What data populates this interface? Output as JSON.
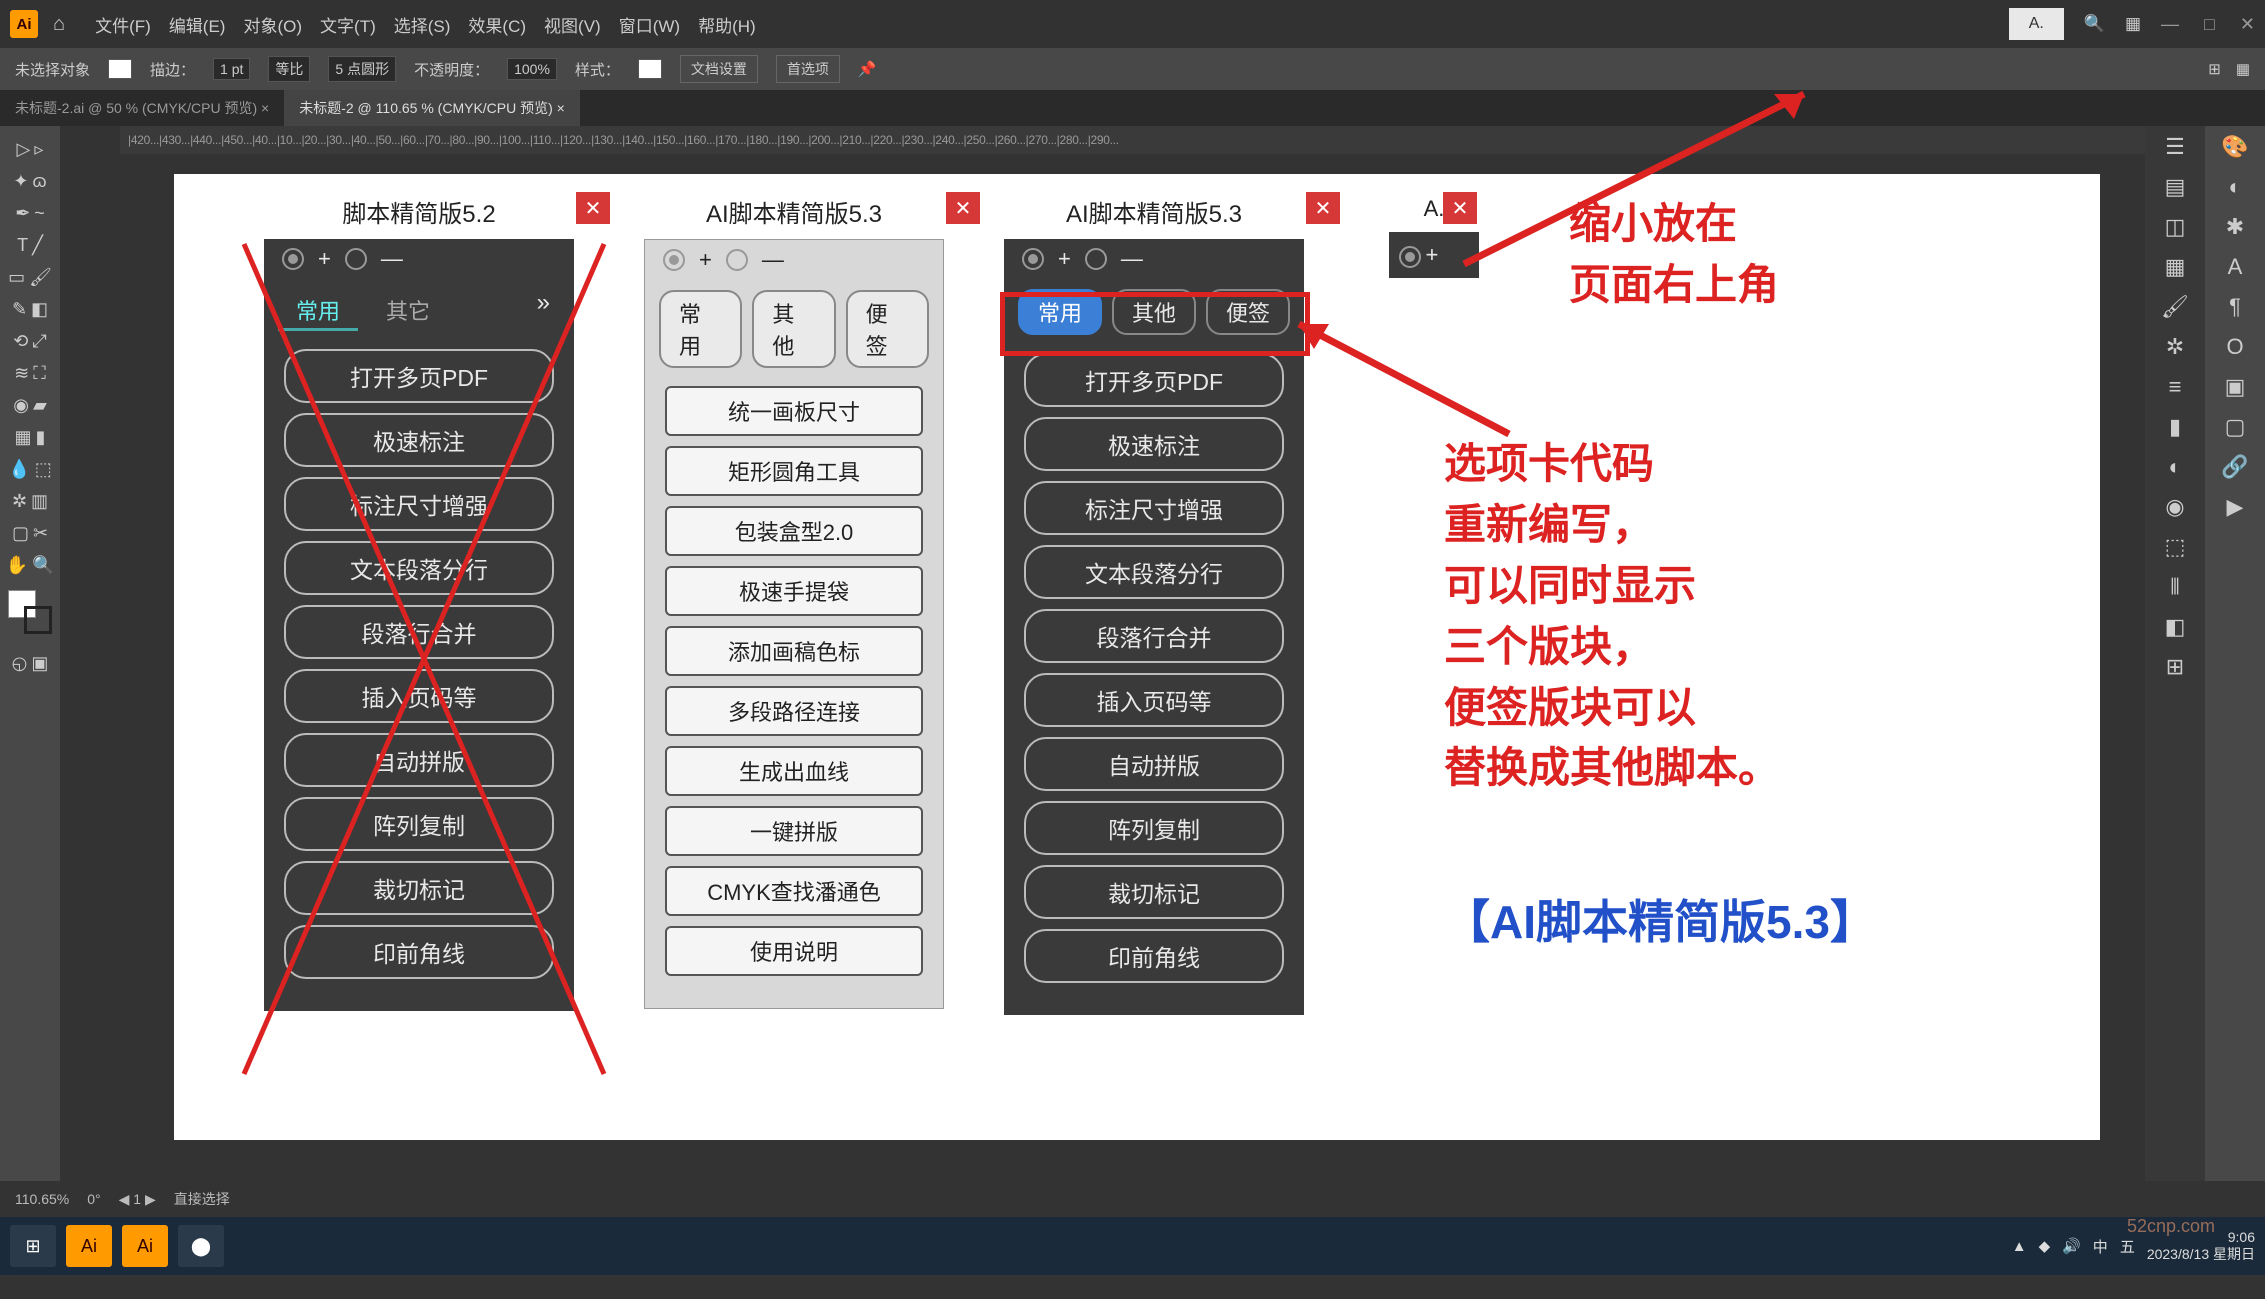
{
  "menu": {
    "file": "文件(F)",
    "edit": "编辑(E)",
    "object": "对象(O)",
    "type": "文字(T)",
    "select": "选择(S)",
    "effect": "效果(C)",
    "view": "视图(V)",
    "window": "窗口(W)",
    "help": "帮助(H)"
  },
  "optbar": {
    "nosel": "未选择对象",
    "stroke": "描边：",
    "strokeV": "1 pt",
    "uniform": "等比",
    "pt5": "5 点圆形",
    "opacity": "不透明度：",
    "opacityV": "100%",
    "style": "样式：",
    "docset": "文档设置",
    "prefs": "首选项"
  },
  "tabs": {
    "t1": "未标题-2.ai @ 50 % (CMYK/CPU 预览)",
    "t2": "未标题-2 @ 110.65 % (CMYK/CPU 预览)"
  },
  "ruler": "|420...|430...|440...|450...|40...|10...|20...|30...|40...|50...|60...|70...|80...|90...|100...|110...|120...|130...|140...|150...|160...|170...|180...|190...|200...|210...|220...|230...|240...|250...|260...|270...|280...|290...",
  "panel52": {
    "title": "脚本精简版5.2",
    "tabs": {
      "a": "常用",
      "b": "其它"
    },
    "btns": [
      "打开多页PDF",
      "极速标注",
      "标注尺寸增强",
      "文本段落分行",
      "段落行合并",
      "插入页码等",
      "自动拼版",
      "阵列复制",
      "裁切标记",
      "印前角线"
    ]
  },
  "panel53L": {
    "title": "AI脚本精简版5.3",
    "tabs": {
      "a": "常用",
      "b": "其他",
      "c": "便签"
    },
    "btns": [
      "统一画板尺寸",
      "矩形圆角工具",
      "包装盒型2.0",
      "极速手提袋",
      "添加画稿色标",
      "多段路径连接",
      "生成出血线",
      "一键拼版",
      "CMYK查找潘通色",
      "使用说明"
    ]
  },
  "panel53D": {
    "title": "AI脚本精简版5.3",
    "tabs": {
      "a": "常用",
      "b": "其他",
      "c": "便签"
    },
    "btns": [
      "打开多页PDF",
      "极速标注",
      "标注尺寸增强",
      "文本段落分行",
      "段落行合并",
      "插入页码等",
      "自动拼版",
      "阵列复制",
      "裁切标记",
      "印前角线"
    ]
  },
  "mini": {
    "title": "A."
  },
  "ann1": {
    "l1": "缩小放在",
    "l2": "页面右上角"
  },
  "ann2": {
    "l1": "选项卡代码",
    "l2": "重新编写，",
    "l3": "可以同时显示",
    "l4": "三个版块，",
    "l5": "便签版块可以",
    "l6": "替换成其他脚本。"
  },
  "ann3": "【AI脚本精简版5.3】",
  "status": {
    "zoom": "110.65%",
    "sel": "直接选择"
  },
  "clock": {
    "time": "9:06",
    "date": "2023/8/13 星期日"
  },
  "corner": "A.",
  "wm": "52cnp.com"
}
